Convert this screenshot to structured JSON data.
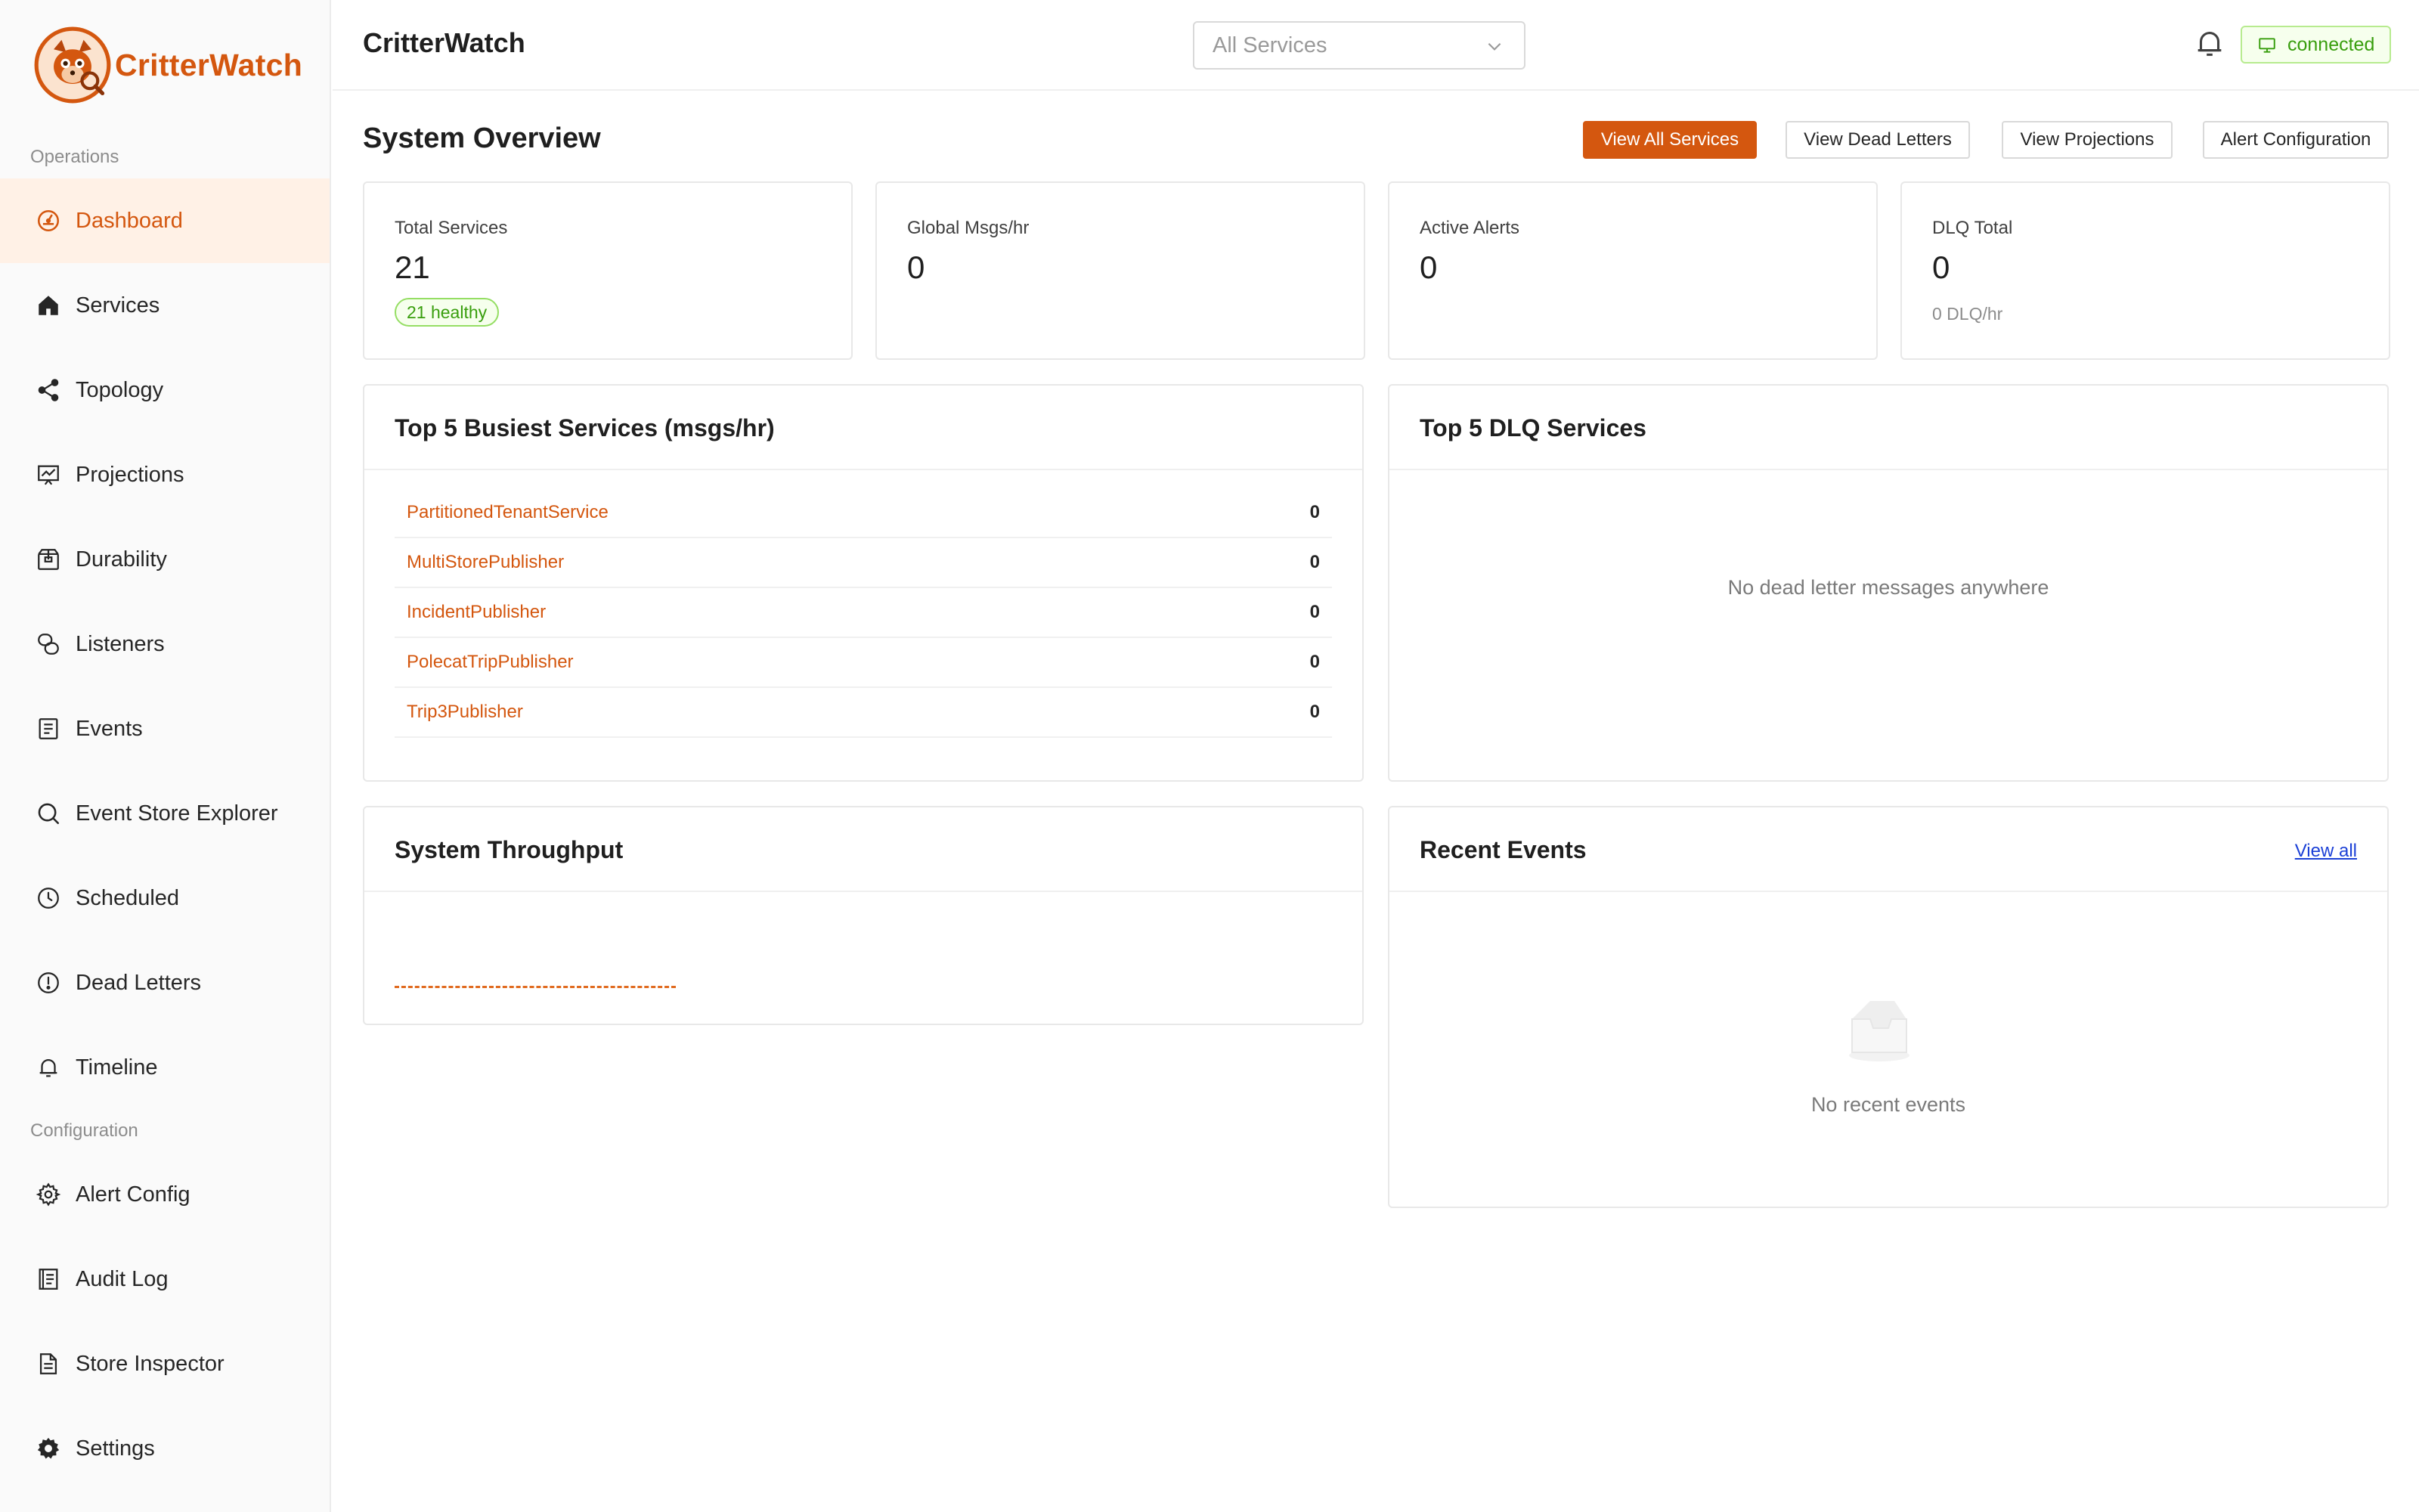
{
  "brand": {
    "name": "CritterWatch"
  },
  "sidebar": {
    "sections": [
      {
        "label": "Operations"
      },
      {
        "label": "Configuration"
      }
    ],
    "items": [
      {
        "label": "Dashboard",
        "icon": "dashboard-icon",
        "active": true
      },
      {
        "label": "Services",
        "icon": "home-icon"
      },
      {
        "label": "Topology",
        "icon": "share-nodes-icon"
      },
      {
        "label": "Projections",
        "icon": "fund-projection-icon"
      },
      {
        "label": "Durability",
        "icon": "box-icon"
      },
      {
        "label": "Listeners",
        "icon": "interaction-icon"
      },
      {
        "label": "Events",
        "icon": "file-text-icon"
      },
      {
        "label": "Event Store Explorer",
        "icon": "search-icon"
      },
      {
        "label": "Scheduled",
        "icon": "clock-icon"
      },
      {
        "label": "Dead Letters",
        "icon": "exclamation-circle-icon"
      },
      {
        "label": "Timeline",
        "icon": "bell-icon"
      },
      {
        "label": "Alert Config",
        "icon": "gear-icon"
      },
      {
        "label": "Audit Log",
        "icon": "book-icon"
      },
      {
        "label": "Store Inspector",
        "icon": "file-icon"
      },
      {
        "label": "Settings",
        "icon": "settings-filled-icon"
      }
    ]
  },
  "header": {
    "title": "CritterWatch",
    "service_filter": {
      "selected": "All Services"
    },
    "connection_status": "connected",
    "colors": {
      "accent": "#d4570f",
      "success": "#389e0d"
    }
  },
  "main": {
    "title": "System Overview",
    "actions": {
      "view_all_services": "View All Services",
      "view_dead_letters": "View Dead Letters",
      "view_projections": "View Projections",
      "alert_configuration": "Alert Configuration"
    },
    "stats": [
      {
        "label": "Total Services",
        "value": "21",
        "badge": "21 healthy"
      },
      {
        "label": "Global Msgs/hr",
        "value": "0"
      },
      {
        "label": "Active Alerts",
        "value": "0"
      },
      {
        "label": "DLQ Total",
        "value": "0",
        "sub": "0 DLQ/hr"
      }
    ],
    "busiest": {
      "title": "Top 5 Busiest Services (msgs/hr)",
      "rows": [
        {
          "name": "PartitionedTenantService",
          "value": "0"
        },
        {
          "name": "MultiStorePublisher",
          "value": "0"
        },
        {
          "name": "IncidentPublisher",
          "value": "0"
        },
        {
          "name": "PolecatTripPublisher",
          "value": "0"
        },
        {
          "name": "Trip3Publisher",
          "value": "0"
        }
      ]
    },
    "dlq": {
      "title": "Top 5 DLQ Services",
      "empty": "No dead letter messages anywhere"
    },
    "throughput": {
      "title": "System Throughput"
    },
    "recent": {
      "title": "Recent Events",
      "link": "View all",
      "empty": "No recent events"
    }
  }
}
